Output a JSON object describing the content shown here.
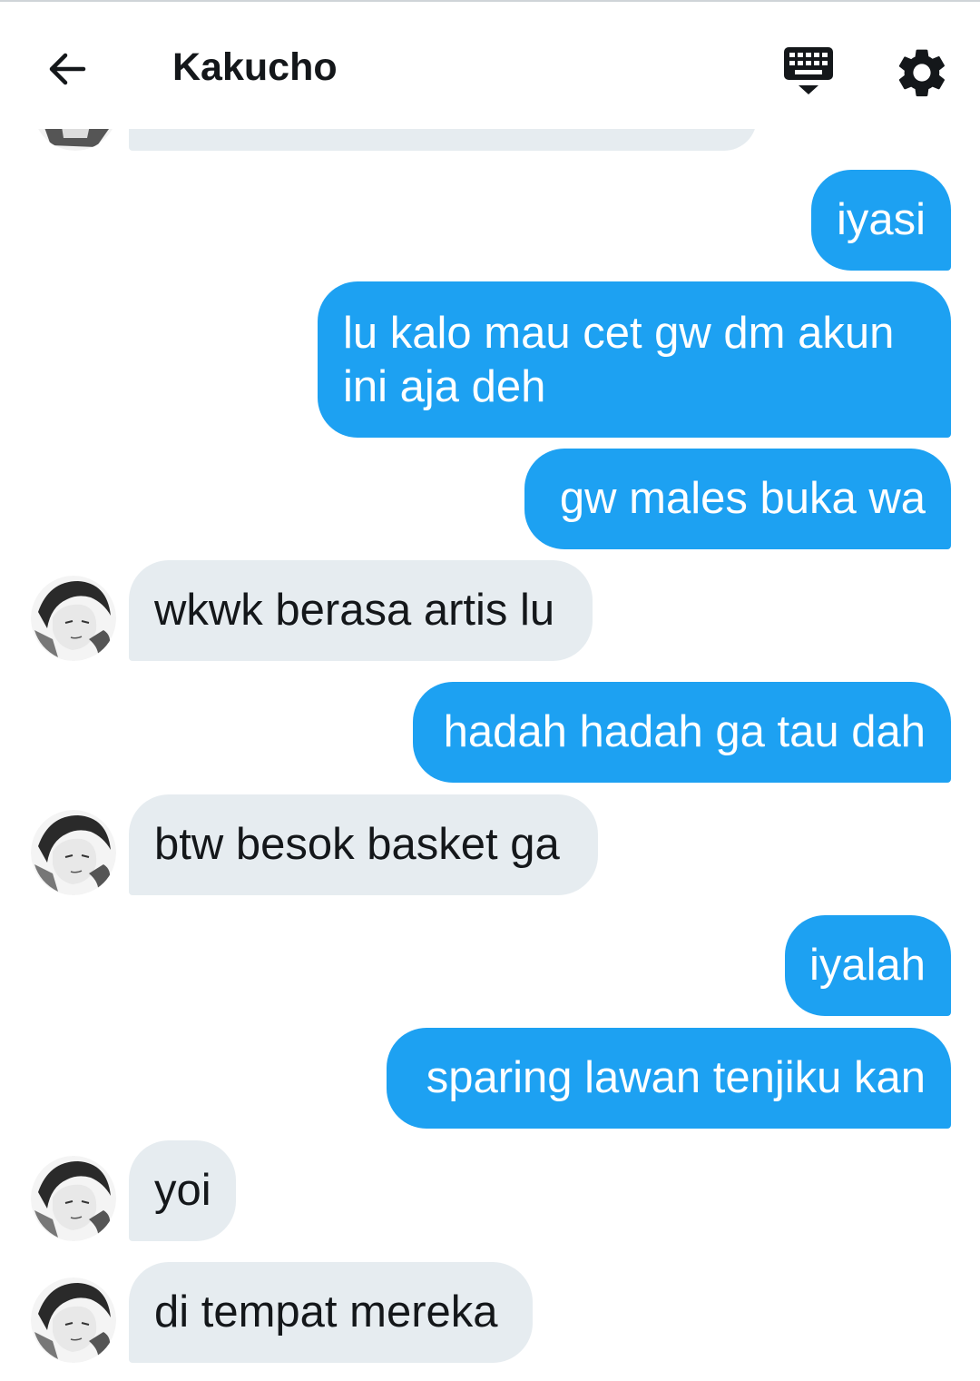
{
  "header": {
    "title": "Kakucho"
  },
  "messages": [
    {
      "id": "m1",
      "direction": "out",
      "text": "iyasi"
    },
    {
      "id": "m2",
      "direction": "out",
      "text": "lu kalo mau cet gw dm akun ini aja deh"
    },
    {
      "id": "m3",
      "direction": "out",
      "text": "gw males buka wa"
    },
    {
      "id": "m4",
      "direction": "in",
      "text": "wkwk berasa artis lu"
    },
    {
      "id": "m5",
      "direction": "out",
      "text": "hadah hadah ga tau dah"
    },
    {
      "id": "m6",
      "direction": "in",
      "text": "btw besok basket ga"
    },
    {
      "id": "m7",
      "direction": "out",
      "text": "iyalah"
    },
    {
      "id": "m8",
      "direction": "out",
      "text": "sparing lawan tenjiku kan"
    },
    {
      "id": "m9",
      "direction": "in",
      "text": "yoi"
    },
    {
      "id": "m10",
      "direction": "in",
      "text": "di tempat mereka"
    }
  ],
  "colors": {
    "outgoing_bubble": "#1da1f2",
    "incoming_bubble": "#e6ecf0",
    "header_text": "#14171a"
  },
  "icons": {
    "back": "arrow-left-icon",
    "keyboard": "keyboard-icon",
    "settings": "gear-icon"
  }
}
